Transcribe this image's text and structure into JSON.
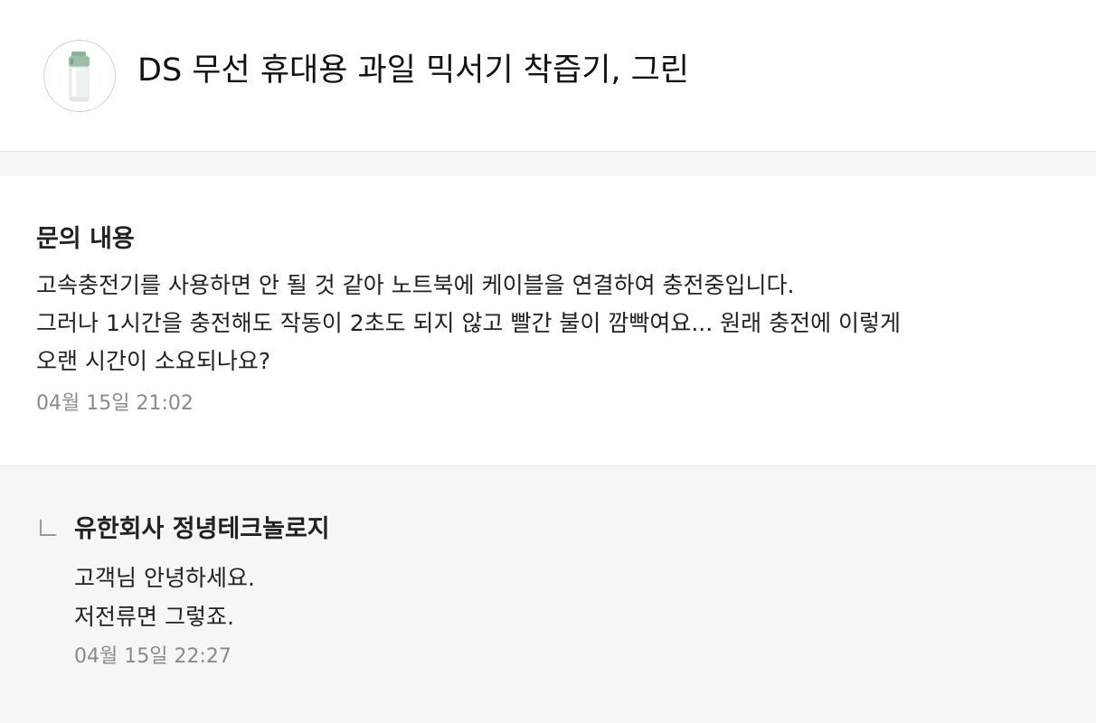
{
  "product": {
    "title": "DS 무선 휴대용 과일 믹서기 착즙기, 그린",
    "image_icon": "blender-product-image"
  },
  "question": {
    "heading": "문의 내용",
    "lines": [
      "고속충전기를 사용하면 안 될 것 같아 노트북에 케이블을 연결하여 충전중입니다.",
      "그러나 1시간을 충전해도 작동이 2초도 되지 않고 빨간 불이 깜빡여요... 원래 충전에 이렇게",
      "오랜 시간이 소요되나요?"
    ],
    "timestamp": "04월 15일 21:02"
  },
  "answer": {
    "reply_icon": "reply-arrow-icon",
    "company": "유한회사 정녕테크놀로지",
    "lines": [
      "고객님 안녕하세요.",
      "저전류면 그렇죠."
    ],
    "timestamp": "04월 15일 22:27"
  },
  "colors": {
    "answer_background": "#f5f6fa",
    "timestamp_text": "#8a8a8a",
    "product_green": "#8fb39a"
  }
}
